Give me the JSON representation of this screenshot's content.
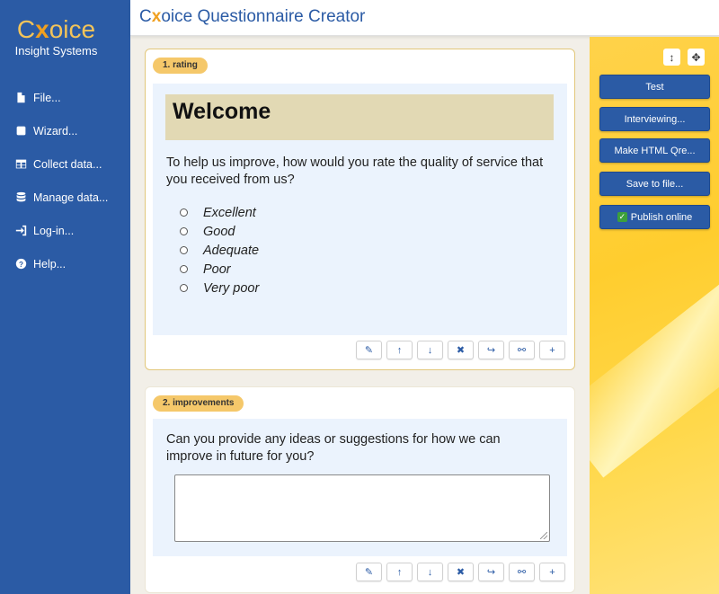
{
  "app": {
    "logo_pre": "C",
    "logo_x": "x",
    "logo_post": "oice",
    "logo_sub": "Insight Systems",
    "title_pre": "C",
    "title_x": "x",
    "title_post": "oice Questionnaire Creator"
  },
  "sidebar": {
    "items": [
      {
        "label": "File...",
        "icon": "file-icon"
      },
      {
        "label": "Wizard...",
        "icon": "square-icon"
      },
      {
        "label": "Collect data...",
        "icon": "table-icon"
      },
      {
        "label": "Manage data...",
        "icon": "database-icon"
      },
      {
        "label": "Log-in...",
        "icon": "login-icon"
      },
      {
        "label": "Help...",
        "icon": "help-icon"
      }
    ]
  },
  "rightpanel": {
    "tool_resize": "↕",
    "tool_move": "✥",
    "buttons": [
      "Test",
      "Interviewing...",
      "Make HTML Qre...",
      "Save to file...",
      "Publish online"
    ],
    "publish_checked": "✓"
  },
  "questions": [
    {
      "tag": "1. rating",
      "heading": "Welcome",
      "text": "To help us improve, how would you rate the quality of service that you received from us?",
      "options": [
        "Excellent",
        "Good",
        "Adequate",
        "Poor",
        "Very poor"
      ]
    },
    {
      "tag": "2. improvements",
      "text": "Can you provide any ideas or suggestions for how we can improve in future for you?",
      "answer_value": ""
    }
  ],
  "toolbar": {
    "edit": "✎",
    "up": "↑",
    "down": "↓",
    "delete": "✖",
    "skip": "↪",
    "link": "⚯",
    "add": "+"
  },
  "colors": {
    "sidebar": "#2b5ba5",
    "accent": "#f0a020",
    "panel": "#ffcd2e",
    "tag": "#f5c86a"
  }
}
